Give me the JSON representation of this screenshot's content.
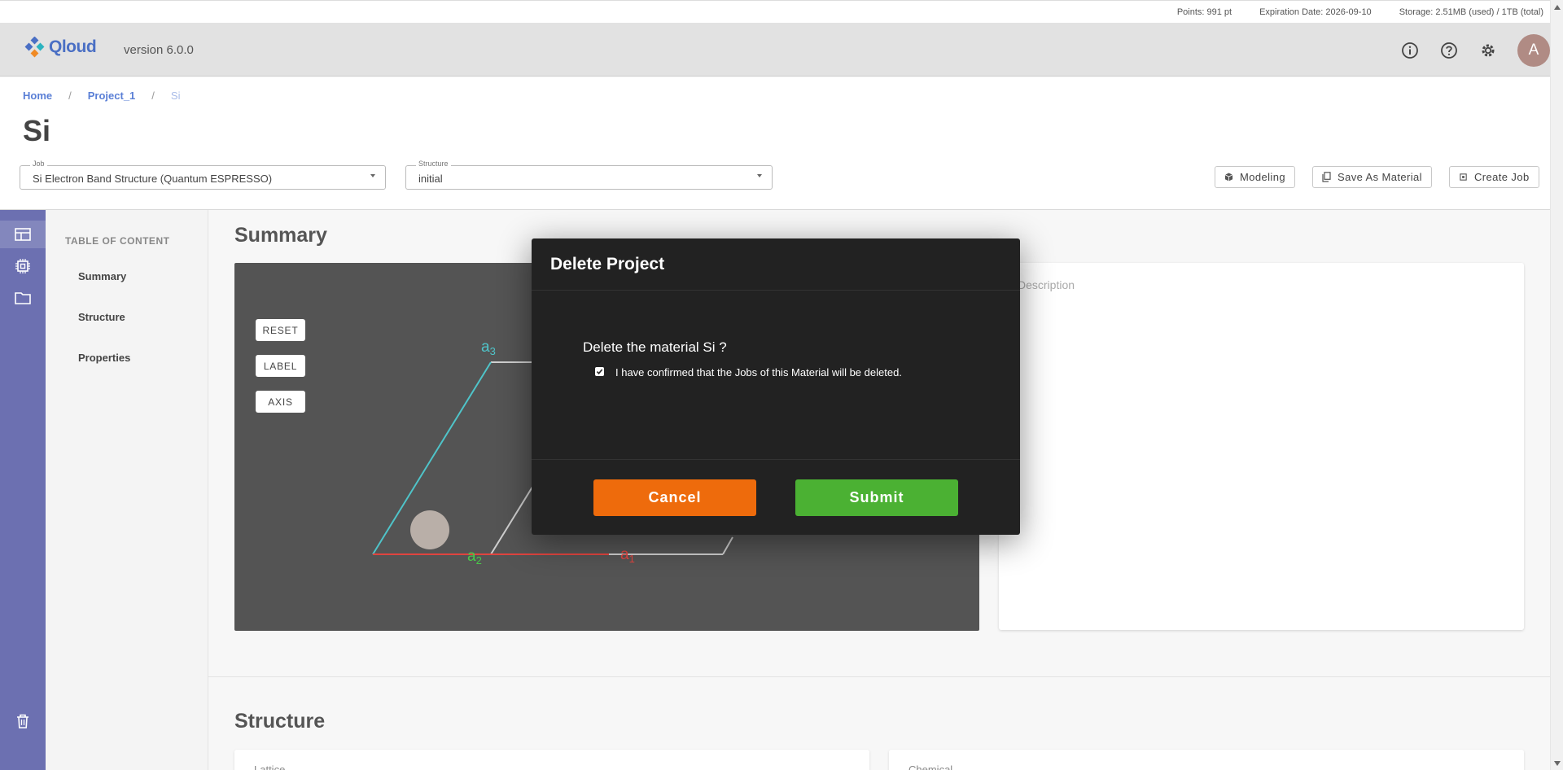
{
  "top_info": {
    "points": "Points: 991 pt",
    "expiration": "Expiration Date: 2026-09-10",
    "storage": "Storage: 2.51MB (used) / 1TB (total)"
  },
  "app": {
    "logo_text": "Qloud",
    "version": "version 6.0.0",
    "avatar_initial": "A"
  },
  "breadcrumb": {
    "home": "Home",
    "project": "Project_1",
    "current": "Si",
    "separator": "/"
  },
  "page_title": "Si",
  "job_select": {
    "label": "Job",
    "value": "Si Electron Band Structure (Quantum ESPRESSO)"
  },
  "structure_select": {
    "label": "Structure",
    "value": "initial"
  },
  "actions": {
    "modeling": "Modeling",
    "save_as_material": "Save As Material",
    "create_job": "Create Job"
  },
  "toc": {
    "title": "TABLE OF CONTENT",
    "items": [
      "Summary",
      "Structure",
      "Properties"
    ]
  },
  "summary": {
    "title": "Summary",
    "viewer_buttons": [
      "RESET",
      "LABEL",
      "AXIS"
    ],
    "axis_labels": {
      "a1": "a",
      "a1_sub": "1",
      "a2": "a",
      "a2_sub": "2",
      "a3": "a",
      "a3_sub": "3"
    },
    "description_placeholder": "Description"
  },
  "structure_section": {
    "title": "Structure",
    "lattice_label": "Lattice",
    "chemical_label": "Chemical"
  },
  "modal": {
    "title": "Delete Project",
    "question": "Delete the material Si ?",
    "confirm_label": "I have confirmed that the Jobs of this Material will be deleted.",
    "confirm_checked": true,
    "cancel": "Cancel",
    "submit": "Submit"
  },
  "colors": {
    "cancel_button": "#ee6b0c",
    "submit_button": "#4bb133",
    "sidebar": "#6c70b1",
    "modal_bg": "#222222",
    "axis_a1": "#e0443f",
    "axis_a2": "#49c94a",
    "axis_a3": "#4fc4c9"
  },
  "icons": {
    "info": "info-icon",
    "help": "help-icon",
    "settings": "gear-icon",
    "sidebar": [
      "summary-icon",
      "chip-icon",
      "folder-icon",
      "trash-icon"
    ]
  }
}
